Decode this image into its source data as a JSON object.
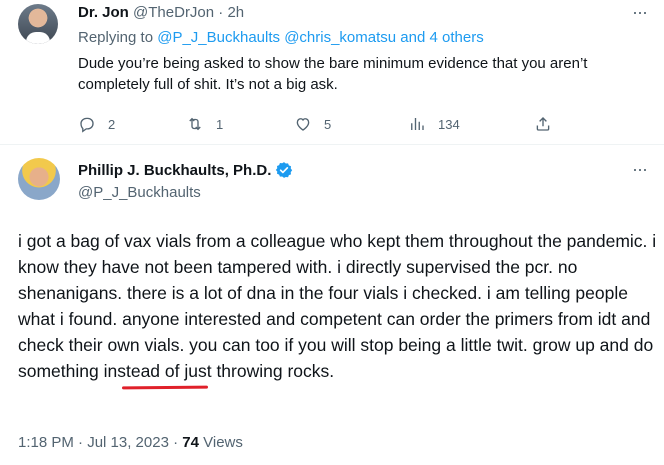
{
  "reply_tweet": {
    "author_name": "Dr. Jon",
    "author_handle": "@TheDrJon",
    "separator": "·",
    "time": "2h",
    "replying_prefix": "Replying to",
    "replying_to_1": "@P_J_Buckhaults",
    "replying_to_2": "@chris_komatsu",
    "replying_to_rest": "and 4 others",
    "text": "Dude you’re being asked to show the bare minimum evidence that you aren’t completely full of shit. It’s not a big ask.",
    "actions": {
      "replies": "2",
      "retweets": "1",
      "likes": "5",
      "views": "134"
    }
  },
  "main_tweet": {
    "author_name": "Phillip J. Buckhaults, Ph.D.",
    "author_handle": "@P_J_Buckhaults",
    "verified": true,
    "text_before": "i got a bag of vax vials from a colleague who kept them throughout the pandemic. i know they have not been tampered with.  i directly supervised the pcr.  no shenanigans.  there is a lot of dna in the four vials i checked.  i am telling people what i found.  anyone interested and competent can order the primers from idt and check their own vials.  you can too if you will stop being a ",
    "text_highlight": "little twit.",
    "text_after": "  grow up and do something instead of just throwing rocks.",
    "timestamp": "1:18 PM · Jul 13, 2023 ·",
    "views_count": "74",
    "views_label": "Views"
  },
  "colors": {
    "accent": "#1d9bf0",
    "muted": "#536471",
    "annotation_underline": "#e0202a"
  },
  "icons": {
    "more": "more-horizontal-icon",
    "reply": "reply-bubble-icon",
    "retweet": "retweet-icon",
    "like": "heart-icon",
    "views": "bar-chart-icon",
    "share": "share-upload-icon",
    "verified": "verified-badge-icon"
  }
}
